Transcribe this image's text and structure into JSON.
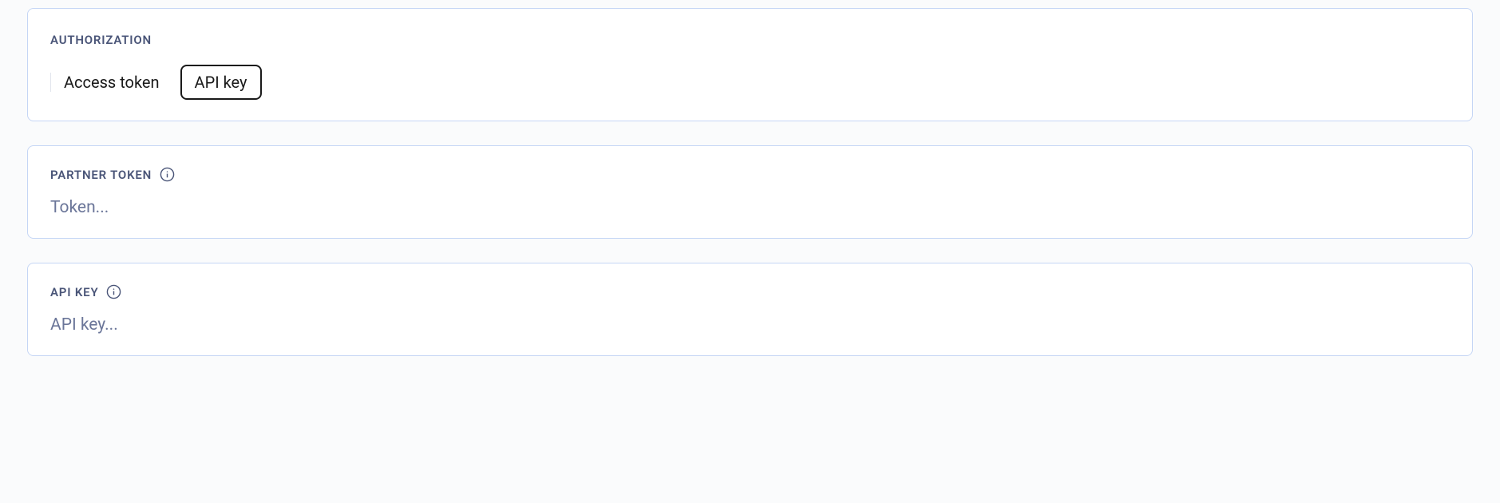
{
  "authorization": {
    "label": "AUTHORIZATION",
    "options": {
      "access_token": "Access token",
      "api_key": "API key"
    },
    "selected": "api_key"
  },
  "partner_token": {
    "label": "PARTNER TOKEN",
    "placeholder": "Token...",
    "value": ""
  },
  "api_key": {
    "label": "API KEY",
    "placeholder": "API key...",
    "value": ""
  }
}
